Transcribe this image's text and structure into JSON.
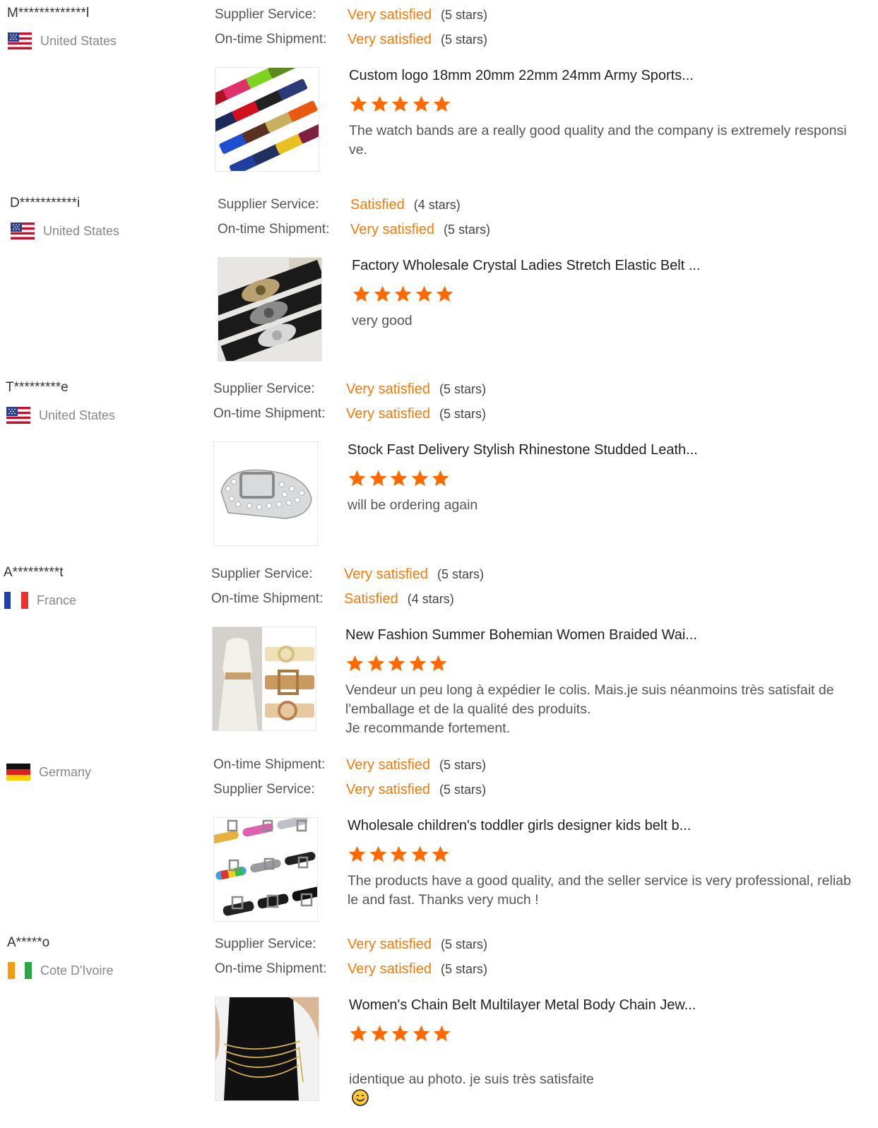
{
  "reviews": [
    {
      "buyer": "M*************l",
      "country": "United States",
      "flag": "us",
      "ratings": [
        {
          "label": "Supplier Service:",
          "value": "Very satisfied",
          "stars": "(5 stars)"
        },
        {
          "label": "On-time Shipment:",
          "value": "Very satisfied",
          "stars": "(5 stars)"
        }
      ],
      "product_title": "Custom logo 18mm 20mm 22mm 24mm Army Sports...",
      "product_image": "nylon-watch-bands",
      "star_count": 5,
      "comment": "The watch bands are a really good quality and the company is extremely responsi\nve."
    },
    {
      "buyer": "D***********i",
      "country": "United States",
      "flag": "us",
      "ratings": [
        {
          "label": "Supplier Service:",
          "value": "Satisfied",
          "stars": "(4 stars)"
        },
        {
          "label": "On-time Shipment:",
          "value": "Very satisfied",
          "stars": "(5 stars)"
        }
      ],
      "product_title": "Factory Wholesale Crystal Ladies Stretch Elastic Belt ...",
      "product_image": "crystal-elastic-belts",
      "star_count": 5,
      "comment": "very good"
    },
    {
      "buyer": "T*********e",
      "country": "United States",
      "flag": "us",
      "ratings": [
        {
          "label": "Supplier Service:",
          "value": "Very satisfied",
          "stars": "(5 stars)"
        },
        {
          "label": "On-time Shipment:",
          "value": "Very satisfied",
          "stars": "(5 stars)"
        }
      ],
      "product_title": "Stock Fast Delivery Stylish Rhinestone Studded Leath...",
      "product_image": "rhinestone-belt",
      "star_count": 5,
      "comment": "will be ordering again"
    },
    {
      "buyer": "A*********t",
      "country": "France",
      "flag": "fr",
      "ratings": [
        {
          "label": "Supplier Service:",
          "value": "Very satisfied",
          "stars": "(5 stars)"
        },
        {
          "label": "On-time Shipment:",
          "value": "Satisfied",
          "stars": "(4 stars)"
        }
      ],
      "product_title": "New Fashion Summer Bohemian Women Braided Wai...",
      "product_image": "braided-waist-belts",
      "star_count": 5,
      "comment": "Vendeur un peu long à expédier le colis. Mais.je suis néanmoins très satisfait de\nl'emballage et de la qualité des produits.\nJe recommande fortement."
    },
    {
      "buyer": "",
      "country": "Germany",
      "flag": "de",
      "ratings": [
        {
          "label": "On-time Shipment:",
          "value": "Very satisfied",
          "stars": "(5 stars)"
        },
        {
          "label": "Supplier Service:",
          "value": "Very satisfied",
          "stars": "(5 stars)"
        }
      ],
      "product_title": "Wholesale children's toddler girls designer kids belt b...",
      "product_image": "kids-belts",
      "star_count": 5,
      "comment": "The products have a good quality, and the seller service is very professional, reliab\nle and fast. Thanks very much !"
    },
    {
      "buyer": "A*****o",
      "country": "Cote D'Ivoire",
      "flag": "ci",
      "ratings": [
        {
          "label": "Supplier Service:",
          "value": "Very satisfied",
          "stars": "(5 stars)"
        },
        {
          "label": "On-time Shipment:",
          "value": "Very satisfied",
          "stars": "(5 stars)"
        }
      ],
      "product_title": "Women's Chain Belt Multilayer Metal Body Chain Jew...",
      "product_image": "chain-belt",
      "star_count": 5,
      "comment": "identique au photo. je suis très satisfaite",
      "comment_emoji": "smiling-face-icon"
    }
  ],
  "colors": {
    "accent": "#f47a0a",
    "star": "#ff6a00",
    "label": "#555555",
    "muted": "#888888"
  }
}
